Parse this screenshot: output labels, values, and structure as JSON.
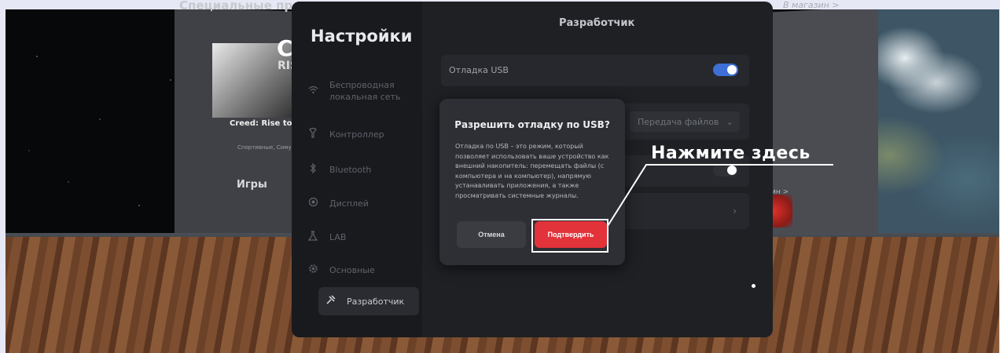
{
  "store": {
    "title": "Специальные пре",
    "shop_link": "В магазин >",
    "promo_logo": "CR",
    "promo_sub": "RIS",
    "promo_name": "Creed: Rise to Glo",
    "promo_category": "Спортивные, Симул",
    "games_label": "Игры",
    "shop_link_2": "газин >"
  },
  "sidebar": {
    "title": "Настройки",
    "items": [
      {
        "icon": "wifi-icon",
        "label": "Беспроводная локальная сеть"
      },
      {
        "icon": "controller-icon",
        "label": "Контроллер"
      },
      {
        "icon": "bluetooth-icon",
        "label": "Bluetooth"
      },
      {
        "icon": "display-icon",
        "label": "Дисплей"
      },
      {
        "icon": "flask-icon",
        "label": "LAB"
      },
      {
        "icon": "gear-icon",
        "label": "Основные"
      },
      {
        "icon": "wrench-icon",
        "label": "Разработчик"
      }
    ]
  },
  "content": {
    "title": "Разработчик",
    "usb_debug_label": "Отладка USB",
    "usb_mode_value": "Передача файлов"
  },
  "dialog": {
    "title": "Разрешить отладку по USB?",
    "body": "Отладка по USB – это режим, который позволяет использовать ваше устройство как внешний накопитель: перемещать файлы (с компьютера и на компьютер), напрямую устанавливать приложения, а также просматривать системные журналы.",
    "cancel_label": "Отмена",
    "confirm_label": "Подтвердить"
  },
  "callout": {
    "text": "Нажмите здесь"
  },
  "colors": {
    "accent_red": "#e2323a",
    "toggle_blue": "#3e6fd6"
  }
}
